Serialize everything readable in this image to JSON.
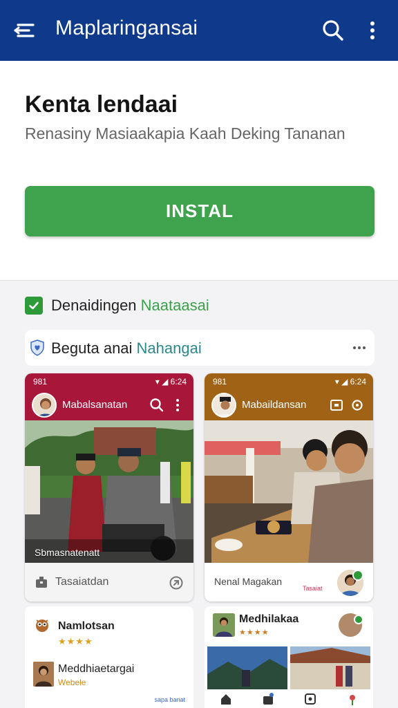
{
  "appbar": {
    "title": "Maplaringansai",
    "menu_icon": "menu-icon",
    "search_icon": "search-icon",
    "more_icon": "more-vert-icon",
    "color": "#0f3a8c"
  },
  "hero": {
    "title": "Kenta lendaai",
    "subtitle": "Renasiny Masiaakapia Kaah Deking Tananan",
    "install_label": "INSTAL",
    "install_color": "#3fa34d"
  },
  "verified": {
    "text_a": "Denaidingen ",
    "text_b": "Naataasai",
    "icon": "check-icon"
  },
  "notice": {
    "text_a": "Beguta anai ",
    "text_b": "Nahangai",
    "icon": "shield-heart-icon",
    "more_icon": "more-horiz-icon"
  },
  "screens": [
    {
      "status_time": "981",
      "status_icons": "▾ ◢ 6:24",
      "app_name": "Mabalsanatan",
      "caption": "Sbmasnatenatt",
      "footer_label": "Tasaiatdan",
      "bar_color": "#a8163a"
    },
    {
      "status_time": "981",
      "status_icons": "▾ ◢ 6:24",
      "app_name": "Mabaildansan",
      "footer_label": "Nenal Magakan",
      "footer_small": "Tasaiat",
      "bar_color": "#a06214"
    }
  ],
  "cards": [
    {
      "title": "Namlotsan",
      "stars": "★★★★",
      "item_title": "Meddhiaetargai",
      "item_sub": "Webele",
      "tiny": "sapa banat"
    },
    {
      "title": "Medhilakaa",
      "stars": "★★★★"
    }
  ]
}
